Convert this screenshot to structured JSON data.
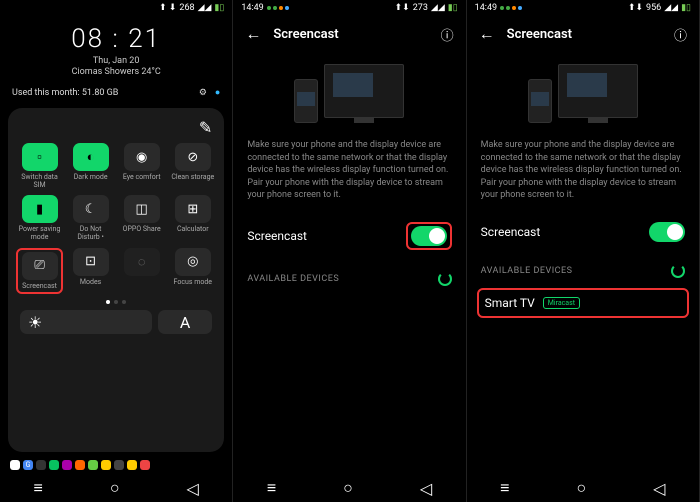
{
  "statusbar": {
    "time": "14:49",
    "signal": "268",
    "net1": "956",
    "net2": "273"
  },
  "lockscreen": {
    "clock": "08 : 21",
    "date": "Thu, Jan 20",
    "weather": "Ciomas Showers 24°C",
    "data_usage": "Used this month: 51.80 GB"
  },
  "tiles": [
    {
      "label": "Switch data SIM",
      "active": true,
      "icon": "▫"
    },
    {
      "label": "Dark mode",
      "active": true,
      "icon": "◐"
    },
    {
      "label": "Eye comfort",
      "active": false,
      "icon": "◉"
    },
    {
      "label": "Clean storage",
      "active": false,
      "icon": "⊘"
    },
    {
      "label": "Power saving mode",
      "active": true,
      "icon": "▮"
    },
    {
      "label": "Do Not Disturb •",
      "active": false,
      "icon": "☾"
    },
    {
      "label": "OPPO Share",
      "active": false,
      "icon": "◫"
    },
    {
      "label": "Calculator",
      "active": false,
      "icon": "⊞"
    },
    {
      "label": "Screencast",
      "active": false,
      "icon": "⎚",
      "highlight": true
    },
    {
      "label": "Modes",
      "active": false,
      "icon": "⊡"
    },
    {
      "label": "",
      "active": false,
      "icon": "◌",
      "dim": true
    },
    {
      "label": "Focus mode",
      "active": false,
      "icon": "◎"
    }
  ],
  "slider_auto": "A",
  "screencast": {
    "title": "Screencast",
    "description": "Make sure your phone and the display device are connected to the same network or that the display device has the wireless display function turned on. Pair your phone with the display device to stream your phone screen to it.",
    "toggle_label": "Screencast",
    "available_label": "AVAILABLE DEVICES",
    "device_name": "Smart TV",
    "device_badge": "Miracast"
  }
}
